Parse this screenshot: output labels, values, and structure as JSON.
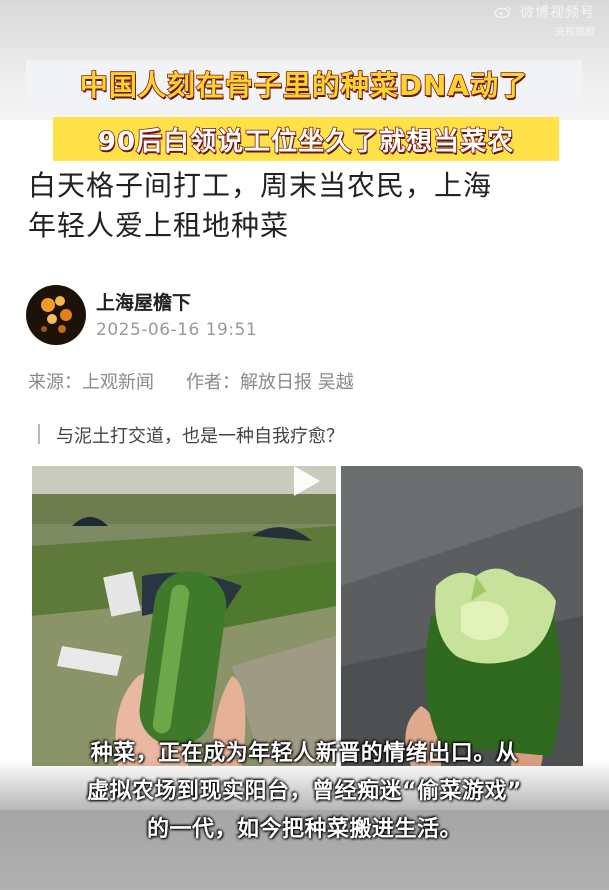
{
  "watermark": {
    "line1": "微博视频号",
    "line2": "央视视频"
  },
  "headline": {
    "banner1": "中国人刻在骨子里的种菜DNA动了",
    "banner2": "90后白领说工位坐久了就想当菜农"
  },
  "article": {
    "title_line1": "白天格子间打工，周末当农民，上海",
    "title_line2": "年轻人爱上租地种菜",
    "author": "上海屋檐下",
    "time": "2025-06-16 19:51",
    "source_label": "来源：上观新闻",
    "author_label": "作者：解放日报 吴越",
    "quote": "与泥土打交道，也是一种自我疗愈？"
  },
  "subtitle": {
    "line1": "种菜，正在成为年轻人新晋的情绪出口。从",
    "line2": "虚拟农场到现实阳台，曾经痴迷“偷菜游戏”",
    "line3": "的一代，如今把种菜搬进生活。"
  },
  "colors": {
    "banner_text": "#fbd433",
    "banner_stroke": "#8b1d12",
    "banner2_bg": "#ffe24a"
  }
}
